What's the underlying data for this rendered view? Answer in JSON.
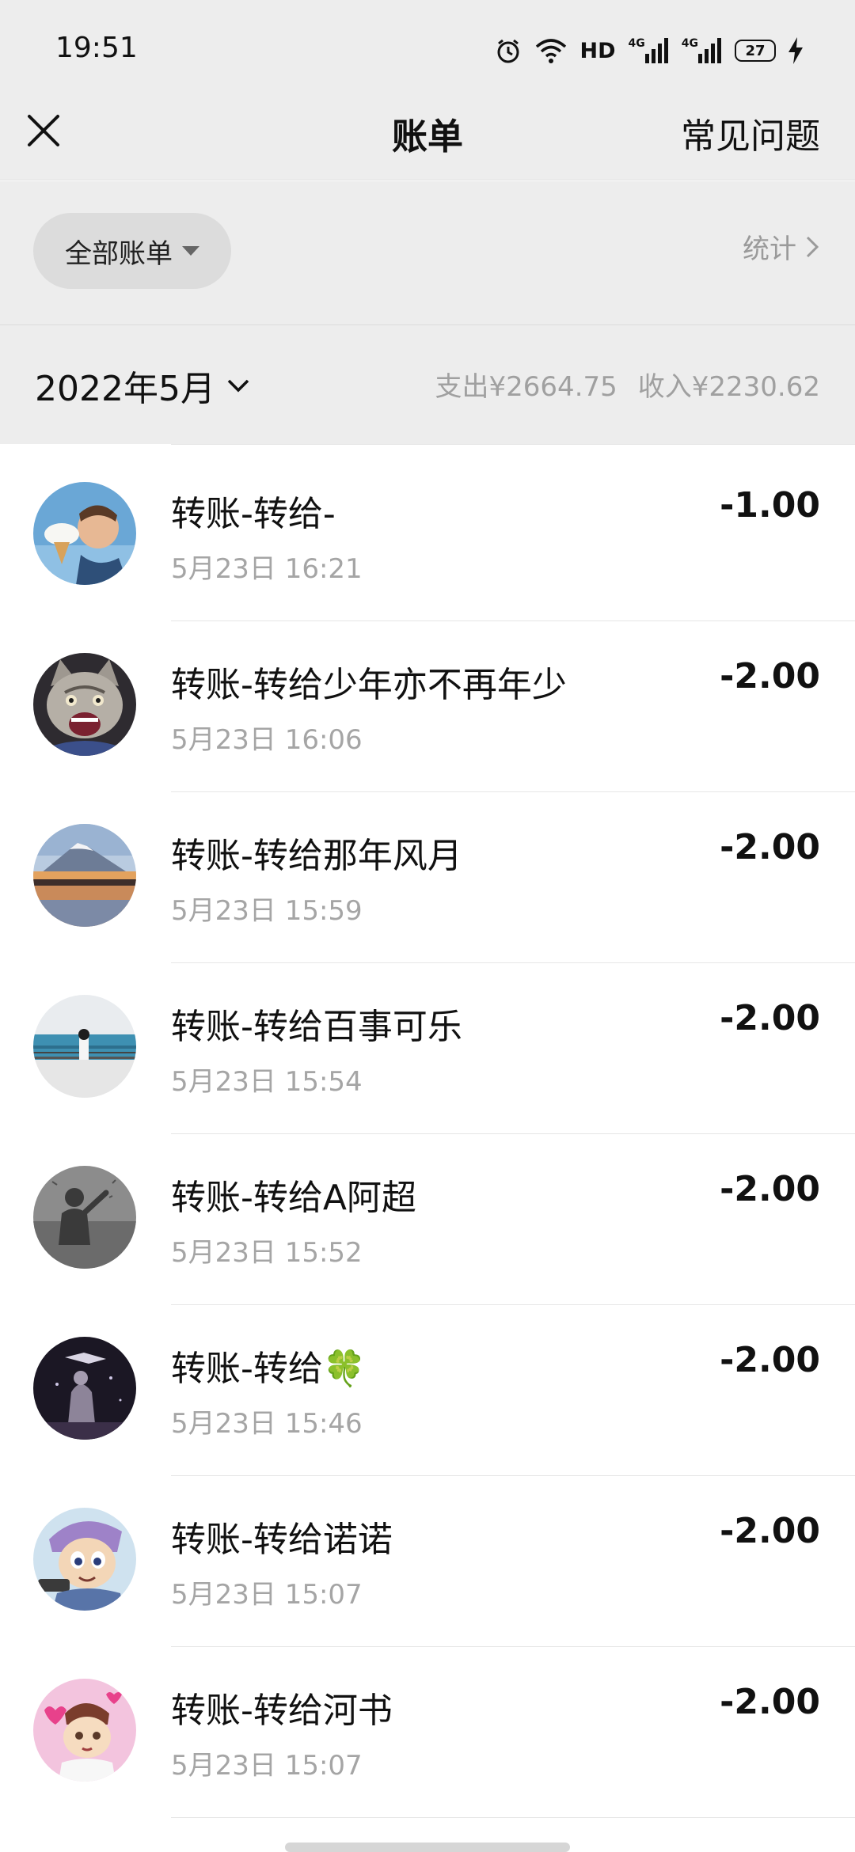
{
  "status_bar": {
    "time": "19:51",
    "network_label": "HD",
    "signal_1": "4G",
    "signal_2": "4G",
    "battery": "27"
  },
  "nav": {
    "title": "账单",
    "faq_label": "常见问题"
  },
  "filter": {
    "all_bills_label": "全部账单",
    "stats_label": "统计"
  },
  "month": {
    "label": "2022年5月",
    "expense": "支出¥2664.75",
    "income": "收入¥2230.62"
  },
  "transactions": [
    {
      "title": "转账-转给-",
      "time": "5月23日 16:21",
      "amount": "-1.00",
      "avatar": "kid-ice-cream-avatar"
    },
    {
      "title": "转账-转给少年亦不再年少",
      "time": "5月23日 16:06",
      "amount": "-2.00",
      "avatar": "cat-avatar"
    },
    {
      "title": "转账-转给那年风月",
      "time": "5月23日 15:59",
      "amount": "-2.00",
      "avatar": "mountain-lake-avatar"
    },
    {
      "title": "转账-转给百事可乐",
      "time": "5月23日 15:54",
      "amount": "-2.00",
      "avatar": "seaside-girl-avatar"
    },
    {
      "title": "转账-转给A阿超",
      "time": "5月23日 15:52",
      "amount": "-2.00",
      "avatar": "grayscale-person-avatar"
    },
    {
      "title": "转账-转给🍀",
      "time": "5月23日 15:46",
      "amount": "-2.00",
      "avatar": "dark-night-avatar"
    },
    {
      "title": "转账-转给诺诺",
      "time": "5月23日 15:07",
      "amount": "-2.00",
      "avatar": "anime-boy-avatar"
    },
    {
      "title": "转账-转给河书",
      "time": "5月23日 15:07",
      "amount": "-2.00",
      "avatar": "pink-cartoon-avatar"
    }
  ]
}
